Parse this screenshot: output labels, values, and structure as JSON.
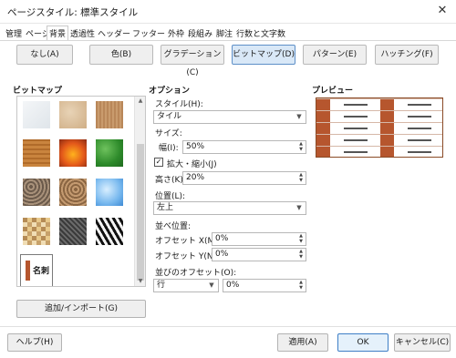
{
  "window": {
    "title": "ページスタイル: 標準スタイル",
    "close_glyph": "✕"
  },
  "tabs": [
    {
      "label": "管理"
    },
    {
      "label": "ページ"
    },
    {
      "label": "背景"
    },
    {
      "label": "透過性"
    },
    {
      "label": "ヘッダー"
    },
    {
      "label": "フッター"
    },
    {
      "label": "外枠"
    },
    {
      "label": "段組み"
    },
    {
      "label": "脚注"
    },
    {
      "label": "行数と文字数"
    }
  ],
  "fill_buttons": [
    {
      "label": "なし(A)"
    },
    {
      "label": "色(B)"
    },
    {
      "label": "グラデーション(C)"
    },
    {
      "label": "ビットマップ(D)"
    },
    {
      "label": "パターン(E)"
    },
    {
      "label": "ハッチング(F)"
    }
  ],
  "bitmap": {
    "heading": "ビットマップ",
    "tiles": [
      {
        "icon": "painted-white-texture"
      },
      {
        "icon": "paper-texture"
      },
      {
        "icon": "wood-grain-texture"
      },
      {
        "icon": "parquet-texture"
      },
      {
        "icon": "fiery-texture"
      },
      {
        "icon": "leaves-texture"
      },
      {
        "icon": "pebbles-texture"
      },
      {
        "icon": "gravel-texture"
      },
      {
        "icon": "sky-texture"
      },
      {
        "icon": "mosaic-texture"
      },
      {
        "icon": "stone-texture"
      },
      {
        "icon": "zebra-texture"
      },
      {
        "icon": "name-card-texture",
        "text": "名刺"
      }
    ],
    "import_label": "追加/インポート(G)"
  },
  "options": {
    "heading": "オプション",
    "style_label": "スタイル(H):",
    "style_value": "タイル",
    "size_label": "サイズ:",
    "width_label": "幅(I):",
    "width_value": "50%",
    "scale_label": "拡大・縮小(J)",
    "scale_checked": true,
    "height_label": "高さ(K):",
    "height_value": "20%",
    "position_label": "位置(L):",
    "position_value": "左上",
    "tiling_label": "並べ位置:",
    "offset_x_label": "オフセット X(M):",
    "offset_x_value": "0%",
    "offset_y_label": "オフセット Y(N):",
    "offset_y_value": "0%",
    "tile_offset_label": "並びのオフセット(O):",
    "tile_offset_mode": "行",
    "tile_offset_value": "0%"
  },
  "preview": {
    "heading": "プレビュー"
  },
  "dialog_buttons": {
    "help": "ヘルプ(H)",
    "apply": "適用(A)",
    "ok": "OK",
    "cancel": "キャンセル(C)"
  },
  "colors": {
    "accent_border": "#3f7fc6",
    "selected_fill": "#d9e8f7",
    "preview_brown": "#b6562e"
  }
}
